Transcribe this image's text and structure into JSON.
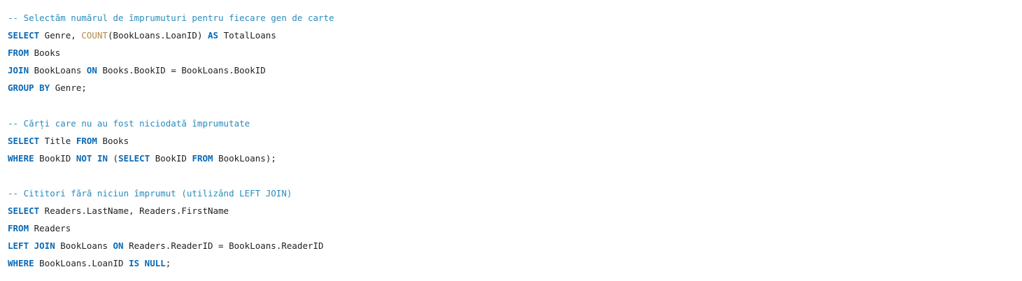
{
  "colors": {
    "keyword": "#0a69b5",
    "function": "#b08a4a",
    "comment": "#2a8bbd",
    "text": "#1f1f1f",
    "background": "#ffffff"
  },
  "code": {
    "lines": [
      [
        {
          "t": "cm",
          "v": "-- Selectăm numărul de împrumuturi pentru fiecare gen de carte"
        }
      ],
      [
        {
          "t": "kw",
          "v": "SELECT"
        },
        {
          "t": "id",
          "v": " Genre, "
        },
        {
          "t": "fn",
          "v": "COUNT"
        },
        {
          "t": "id",
          "v": "(BookLoans.LoanID) "
        },
        {
          "t": "kw",
          "v": "AS"
        },
        {
          "t": "id",
          "v": " TotalLoans"
        }
      ],
      [
        {
          "t": "kw",
          "v": "FROM"
        },
        {
          "t": "id",
          "v": " Books"
        }
      ],
      [
        {
          "t": "kw",
          "v": "JOIN"
        },
        {
          "t": "id",
          "v": " BookLoans "
        },
        {
          "t": "kw",
          "v": "ON"
        },
        {
          "t": "id",
          "v": " Books.BookID = BookLoans.BookID"
        }
      ],
      [
        {
          "t": "kw",
          "v": "GROUP BY"
        },
        {
          "t": "id",
          "v": " Genre;"
        }
      ],
      [],
      [
        {
          "t": "cm",
          "v": "-- Cărți care nu au fost niciodată împrumutate"
        }
      ],
      [
        {
          "t": "kw",
          "v": "SELECT"
        },
        {
          "t": "id",
          "v": " Title "
        },
        {
          "t": "kw",
          "v": "FROM"
        },
        {
          "t": "id",
          "v": " Books"
        }
      ],
      [
        {
          "t": "kw",
          "v": "WHERE"
        },
        {
          "t": "id",
          "v": " BookID "
        },
        {
          "t": "kw",
          "v": "NOT IN"
        },
        {
          "t": "id",
          "v": " ("
        },
        {
          "t": "kw",
          "v": "SELECT"
        },
        {
          "t": "id",
          "v": " BookID "
        },
        {
          "t": "kw",
          "v": "FROM"
        },
        {
          "t": "id",
          "v": " BookLoans);"
        }
      ],
      [],
      [
        {
          "t": "cm",
          "v": "-- Cititori fără niciun împrumut (utilizând LEFT JOIN)"
        }
      ],
      [
        {
          "t": "kw",
          "v": "SELECT"
        },
        {
          "t": "id",
          "v": " Readers.LastName, Readers.FirstName"
        }
      ],
      [
        {
          "t": "kw",
          "v": "FROM"
        },
        {
          "t": "id",
          "v": " Readers"
        }
      ],
      [
        {
          "t": "kw",
          "v": "LEFT JOIN"
        },
        {
          "t": "id",
          "v": " BookLoans "
        },
        {
          "t": "kw",
          "v": "ON"
        },
        {
          "t": "id",
          "v": " Readers.ReaderID = BookLoans.ReaderID"
        }
      ],
      [
        {
          "t": "kw",
          "v": "WHERE"
        },
        {
          "t": "id",
          "v": " BookLoans.LoanID "
        },
        {
          "t": "kw",
          "v": "IS NULL"
        },
        {
          "t": "id",
          "v": ";"
        }
      ]
    ]
  }
}
